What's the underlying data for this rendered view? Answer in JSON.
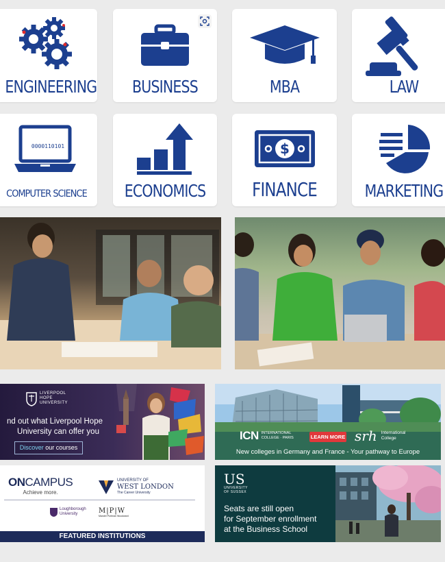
{
  "categories": {
    "engineering": "ENGINEERING",
    "business": "BUSINESS",
    "mba": "MBA",
    "law": "LAW",
    "computer_science": "COMPUTER SCIENCE",
    "computer_screen_digits": "0000110101",
    "economics": "ECONOMICS",
    "finance": "FINANCE",
    "marketing": "MARKETING"
  },
  "banners": {
    "liverpool": {
      "logo_line1": "LIVERPOOL",
      "logo_line2": "HOPE",
      "logo_line3": "UNIVERSITY",
      "line1": "nd out what Liverpool Hope",
      "line2": "University can offer you",
      "cta_prefix": "Discover",
      "cta_suffix": " our courses"
    },
    "icn": {
      "logo": "ICN",
      "logo_sub1": "INTERNATIONAL",
      "logo_sub2": "COLLEGE · PARIS",
      "learn_more": "LEARN MORE",
      "srh": "srh",
      "srh_sub1": "International",
      "srh_sub2": "College",
      "tagline": "New colleges in Germany and France - Your pathway to Europe"
    },
    "oncampus": {
      "on": "ON",
      "campus": "CAMPUS",
      "sub": "Achieve more.",
      "uwl1": "UNIVERSITY OF",
      "uwl2": "WEST LONDON",
      "uwl3": "The Career University",
      "lboro1": "Loughborough",
      "lboro2": "University",
      "mpw": "M|P|W",
      "mpw_sub": "Mander Portman Woodward",
      "featured": "FEATURED INSTITUTIONS"
    },
    "sussex": {
      "logo": "US",
      "logo_sub1": "UNIVERSITY",
      "logo_sub2": "OF SUSSEX",
      "line1": "Seats are still open",
      "line2": "for September enrollment",
      "line3": "at the Business School"
    }
  },
  "colors": {
    "brand_blue": "#1c3f8f",
    "icn_green": "#2f6b55",
    "sussex_teal": "#0e3b3f",
    "featured_navy": "#1d2b5a"
  }
}
